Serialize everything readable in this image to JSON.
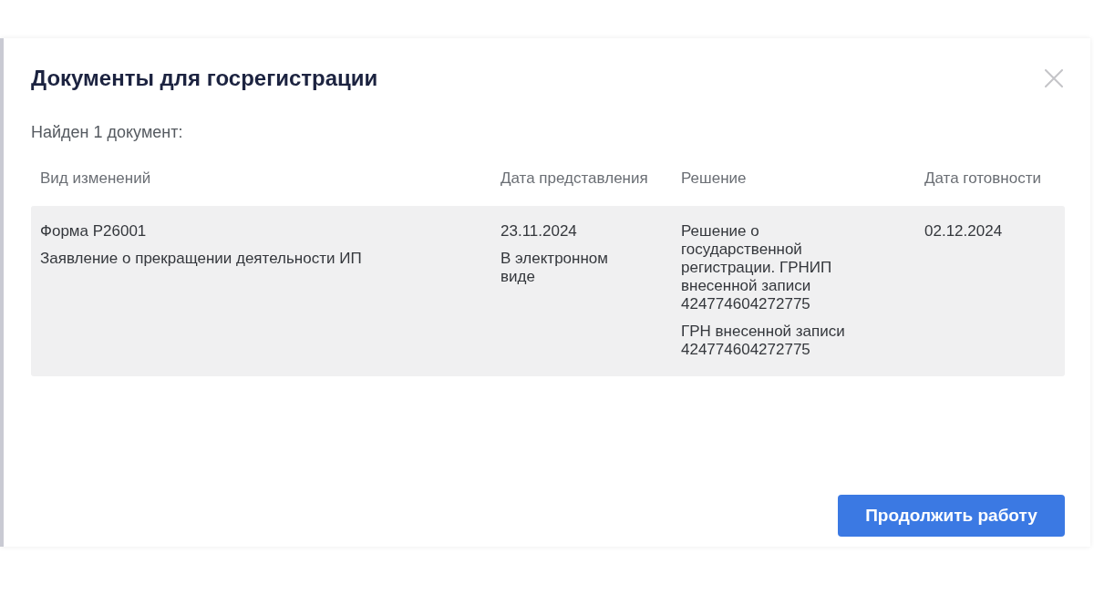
{
  "dialog": {
    "title": "Документы для госрегистрации",
    "summary": "Найден 1 документ:",
    "table": {
      "columns": [
        "Вид изменений",
        "Дата представления",
        "Решение",
        "Дата готовности"
      ],
      "rows": [
        {
          "cells": [
            [
              "Форма Р26001",
              "Заявление о прекращении деятельности ИП"
            ],
            [
              "23.11.2024",
              "В электронном виде"
            ],
            [
              "Решение о государственной регистрации. ГРНИП внесенной записи 424774604272775",
              "ГРН внесенной записи 424774604272775"
            ],
            [
              "02.12.2024"
            ]
          ]
        }
      ]
    },
    "buttons": [
      "Продолжить работу"
    ]
  }
}
